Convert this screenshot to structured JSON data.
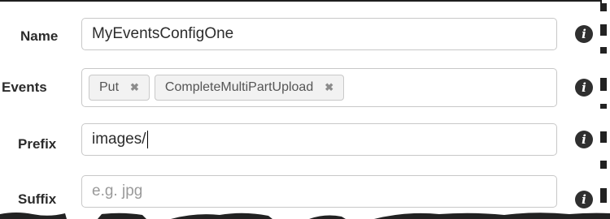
{
  "form": {
    "name": {
      "label": "Name",
      "value": "MyEventsConfigOne"
    },
    "events": {
      "label": "Events",
      "tags": [
        {
          "label": "Put"
        },
        {
          "label": "CompleteMultiPartUpload"
        }
      ]
    },
    "prefix": {
      "label": "Prefix",
      "value": "images/"
    },
    "suffix": {
      "label": "Suffix",
      "placeholder": "e.g. jpg"
    }
  },
  "icons": {
    "info": "info-circle-icon",
    "remove": "remove-x-icon"
  },
  "colors": {
    "label": "#2b2b2b",
    "border": "#c8c8c8",
    "tag_bg": "#f2f2f2",
    "info_icon": "#2f2f2f",
    "placeholder": "#9a9a9a"
  }
}
